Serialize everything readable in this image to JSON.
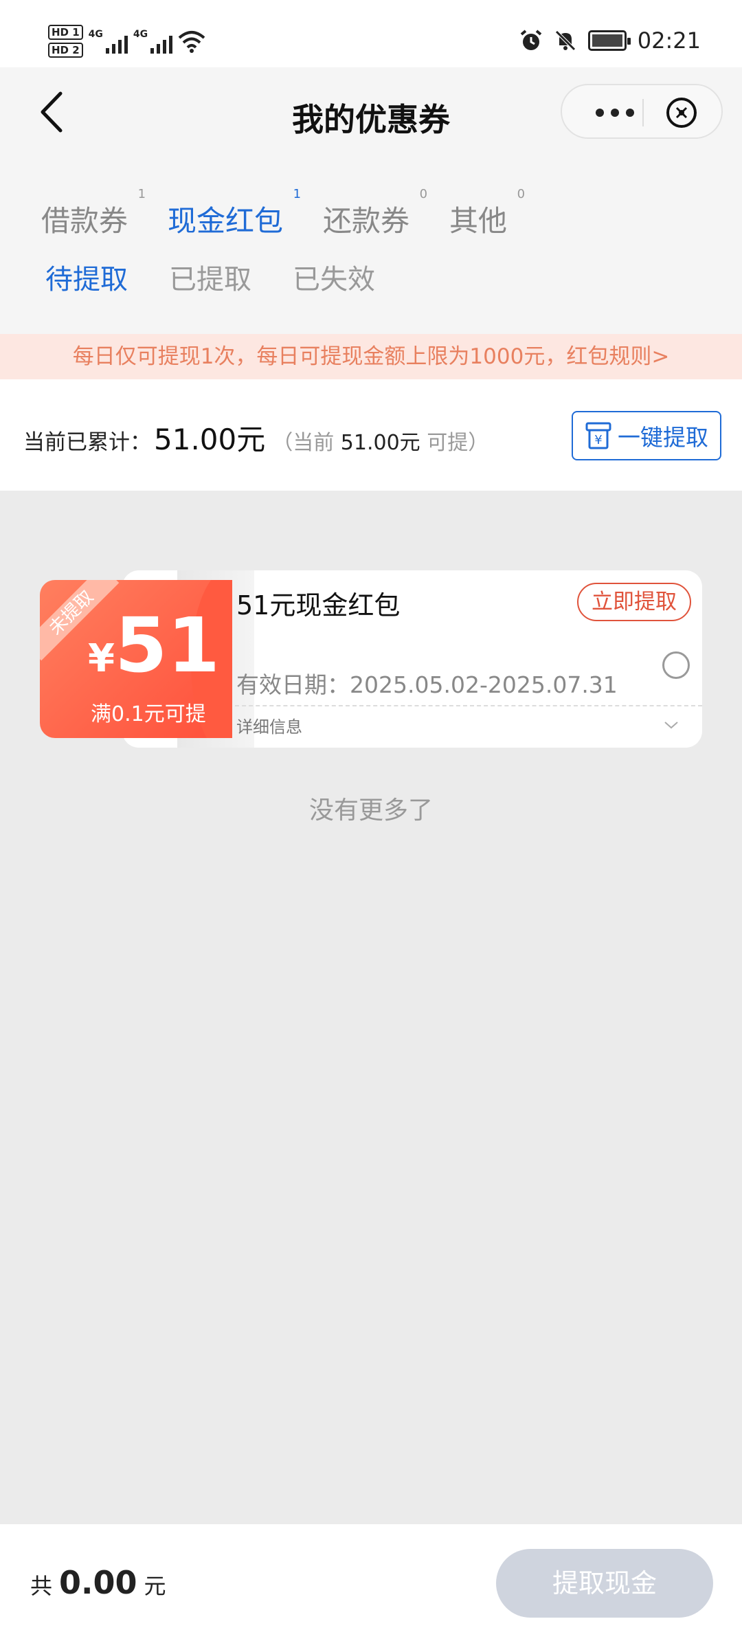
{
  "status_bar": {
    "sim1": "HD 1",
    "sim2": "HD 2",
    "net1": "4G",
    "net2": "4G",
    "time": "02:21",
    "icons": [
      "alarm-icon",
      "mute-icon",
      "battery-icon"
    ]
  },
  "header": {
    "title": "我的优惠券"
  },
  "tabs": [
    {
      "label": "借款券",
      "count": "1"
    },
    {
      "label": "现金红包",
      "count": "1"
    },
    {
      "label": "还款券",
      "count": "0"
    },
    {
      "label": "其他",
      "count": "0"
    }
  ],
  "subtabs": [
    "待提取",
    "已提取",
    "已失效"
  ],
  "notice": "每日仅可提现1次，每日可提现金额上限为1000元，红包规则>",
  "summary": {
    "label": "当前已累计：",
    "amount": "51.00元",
    "paren_open": "（当前 ",
    "available": "51.00元",
    "paren_close": " 可提）",
    "button": "一键提取"
  },
  "coupon": {
    "ribbon": "未提取",
    "currency": "¥",
    "value": "51",
    "condition": "满0.1元可提",
    "title": "51元现金红包",
    "action": "立即提取",
    "validity": "有效日期：2025.05.02-2025.07.31",
    "detail": "详细信息"
  },
  "no_more": "没有更多了",
  "footer": {
    "total_prefix": "共",
    "total_amount": "0.00",
    "total_unit": "元",
    "withdraw_button": "提取现金"
  },
  "colors": {
    "accent": "#1f6bd6",
    "coupon_red": "#ff5a40",
    "notice_text": "#e8805f",
    "disabled_button": "#cfd4de"
  }
}
